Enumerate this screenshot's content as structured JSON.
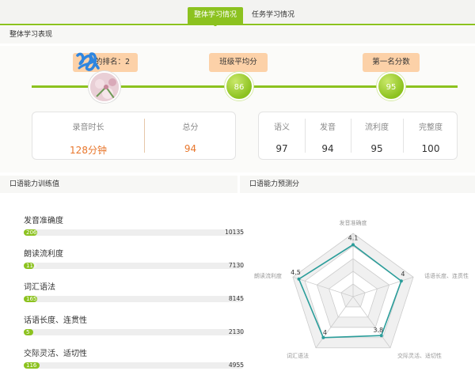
{
  "tabs": [
    {
      "label": "整体学习情况",
      "active": true
    },
    {
      "label": "任务学习情况",
      "active": false
    }
  ],
  "overall": {
    "title": "整体学习表现",
    "rank_label": "的排名：2",
    "class_avg_label": "班级平均分",
    "class_avg_value": "86",
    "top_score_label": "第一名分数",
    "top_score_value": "95"
  },
  "summary": {
    "record_time_label": "录音时长",
    "record_time_value": "128分钟",
    "total_label": "总分",
    "total_value": "94"
  },
  "scores": {
    "semantic_label": "语义",
    "semantic_value": "97",
    "pronunciation_label": "发音",
    "pronunciation_value": "94",
    "fluency_label": "流利度",
    "fluency_value": "95",
    "completeness_label": "完整度",
    "completeness_value": "100"
  },
  "ability": {
    "title": "口语能力训练值",
    "items": [
      {
        "label": "发音准确度",
        "value": "206",
        "max": "10135",
        "fraction": 0.0203
      },
      {
        "label": "朗读流利度",
        "value": "113",
        "max": "7130",
        "fraction": 0.0158
      },
      {
        "label": "词汇语法",
        "value": "165",
        "max": "8145",
        "fraction": 0.0203
      },
      {
        "label": "话语长度、连贯性",
        "value": "5",
        "max": "2130",
        "fraction": 0.0023
      },
      {
        "label": "交际灵活、适切性",
        "value": "116",
        "max": "4955",
        "fraction": 0.0234
      }
    ]
  },
  "radar": {
    "title": "口语能力预测分",
    "max": 5,
    "axes": [
      {
        "label": "发音准确度",
        "value": 4.1,
        "text": "4.1"
      },
      {
        "label": "话语长度、连贯性",
        "value": 4,
        "text": "4"
      },
      {
        "label": "交际灵活、适切性",
        "value": 3.8,
        "text": "3.8"
      },
      {
        "label": "词汇语法",
        "value": 4,
        "text": "4"
      },
      {
        "label": "朗读流利度",
        "value": 4.5,
        "text": "4.5"
      }
    ],
    "line_color": "#2a9d9a"
  },
  "colors": {
    "accent": "#8cc21f",
    "tag": "#fcd1a8",
    "orange": "#e8762b"
  }
}
